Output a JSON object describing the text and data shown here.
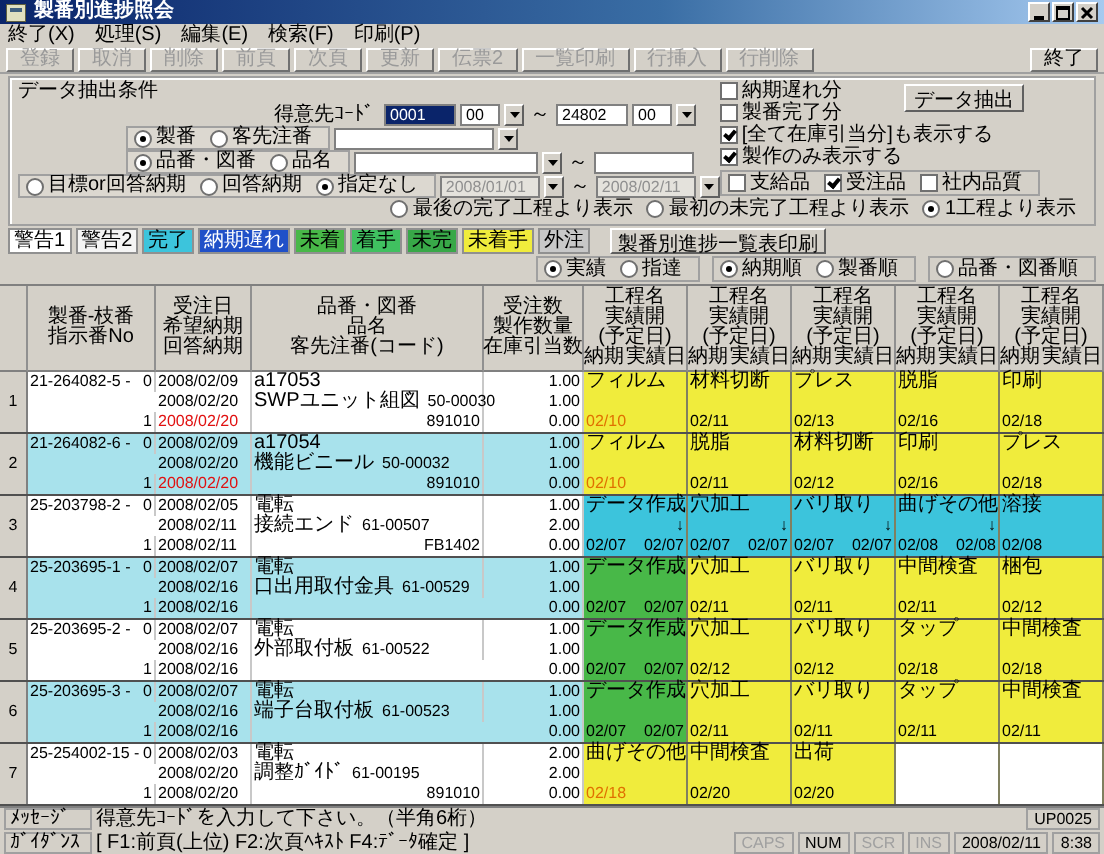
{
  "window": {
    "title": "製番別進捗照会"
  },
  "menu": [
    "終了(X)",
    "処理(S)",
    "編集(E)",
    "検索(F)",
    "印刷(P)"
  ],
  "toolbar": [
    {
      "label": "登録",
      "disabled": true
    },
    {
      "label": "取消",
      "disabled": true
    },
    {
      "label": "削除",
      "disabled": true
    },
    {
      "label": "前頁",
      "disabled": true
    },
    {
      "label": "次頁",
      "disabled": true
    },
    {
      "label": "更新",
      "disabled": true
    },
    {
      "label": "伝票2",
      "disabled": true
    },
    {
      "label": "一覧印刷",
      "disabled": true
    },
    {
      "label": "行挿入",
      "disabled": true
    },
    {
      "label": "行削除",
      "disabled": true
    },
    {
      "label": "終了",
      "disabled": false
    }
  ],
  "conditions": {
    "title": "データ抽出条件",
    "customer": {
      "label": "得意先ｺｰﾄﾞ",
      "from_code": "0001",
      "from_code_highlighted": true,
      "from_branch": "00",
      "separator": "～",
      "to_code": "24802",
      "to_branch": "00"
    },
    "order_type": [
      {
        "label": "製番",
        "selected": true
      },
      {
        "label": "客先注番",
        "selected": false
      }
    ],
    "part_type": [
      {
        "label": "品番・図番",
        "selected": true
      },
      {
        "label": "品名",
        "selected": false
      }
    ],
    "part_separator": "～",
    "date_type": [
      {
        "label": "目標or回答納期",
        "selected": false
      },
      {
        "label": "回答納期",
        "selected": false
      },
      {
        "label": "指定なし",
        "selected": true
      }
    ],
    "date_range": {
      "from": "2008/01/01",
      "separator": "～",
      "to": "2008/02/11",
      "disabled": true
    },
    "flags": [
      {
        "label": "納期遅れ分",
        "checked": false
      },
      {
        "label": "製番完了分",
        "checked": false
      },
      {
        "label": "[全て在庫引当分]も表示する",
        "checked": true
      },
      {
        "label": "製作のみ表示する",
        "checked": true
      }
    ],
    "extract_button": "データ抽出",
    "categories": [
      {
        "label": "支給品",
        "checked": false
      },
      {
        "label": "受注品",
        "checked": true
      },
      {
        "label": "社内品質",
        "checked": false
      }
    ],
    "display_from": [
      {
        "label": "最後の完了工程より表示",
        "selected": false
      },
      {
        "label": "最初の未完了工程より表示",
        "selected": false
      },
      {
        "label": "1工程より表示",
        "selected": true
      }
    ]
  },
  "legend": [
    {
      "label": "警告1",
      "color": "#ffffff"
    },
    {
      "label": "警告2",
      "color": "#f4f4f4"
    },
    {
      "label": "完了",
      "color": "#3cc4dc"
    },
    {
      "label": "納期遅れ",
      "color": "#2050c8"
    },
    {
      "label": "未着",
      "color": "#48b848"
    },
    {
      "label": "着手",
      "color": "#40c060"
    },
    {
      "label": "未完",
      "color": "#38a848"
    },
    {
      "label": "未着手",
      "color": "#f0ec3c"
    },
    {
      "label": "外注",
      "color": "#c8c8c8"
    }
  ],
  "print_button": "製番別進捗一覧表印刷",
  "view_mode": [
    {
      "label": "実績",
      "selected": true
    },
    {
      "label": "指達",
      "selected": false
    }
  ],
  "sort_order": [
    {
      "label": "納期順",
      "selected": true
    },
    {
      "label": "製番順",
      "selected": false
    },
    {
      "label": "品番・図番順",
      "selected": false
    }
  ],
  "table": {
    "columns": [
      [
        "製番-枝番",
        "指示番No"
      ],
      [
        "受注日",
        "希望納期",
        "回答納期"
      ],
      [
        "品番・図番",
        "品名",
        "客先注番(コード)"
      ],
      [
        "受注数",
        "製作数量",
        "在庫引当数"
      ]
    ],
    "process_columns": [
      {
        "name": "工程名",
        "start": "実績開(予定日)",
        "due": "納期",
        "actual": "実績日"
      },
      {
        "name": "工程名",
        "start": "実績開(予定日)",
        "due": "納期",
        "actual": "実績日"
      },
      {
        "name": "工程名",
        "start": "実績開(予定日)",
        "due": "納期",
        "actual": "実績日"
      },
      {
        "name": "工程名",
        "start": "実績開(予定日)",
        "due": "納期",
        "actual": "実績日"
      },
      {
        "name": "工程名",
        "start": "実績開(予定日)",
        "due": "納期",
        "actual": "実績日"
      }
    ],
    "rows": [
      {
        "number": "1",
        "shaded": false,
        "order_no": "21-264082-5 -",
        "seq": "0",
        "split": "1",
        "order_date": "2008/02/09",
        "due_date": "2008/02/20",
        "answer_date": "2008/02/20",
        "answer_late": true,
        "part_no": "a17053",
        "part_name": "SWPユニット組図",
        "drawing_no": "50-00030",
        "customer_code": "891010",
        "qty": "1.00",
        "make_qty": "1.00",
        "stock_qty": "0.00",
        "processes": [
          {
            "name": "フィルム",
            "kind": "pending",
            "due": "02/10",
            "due_late": true
          },
          {
            "name": "材料切断",
            "kind": "pending",
            "due": "02/11",
            "due_late": false
          },
          {
            "name": "プレス",
            "kind": "pending",
            "due": "02/13",
            "due_late": false
          },
          {
            "name": "脱脂",
            "kind": "pending",
            "due": "02/16",
            "due_late": false
          },
          {
            "name": "印刷",
            "kind": "pending",
            "due": "02/18",
            "due_late": false
          }
        ]
      },
      {
        "number": "2",
        "shaded": true,
        "order_no": "21-264082-6 -",
        "seq": "0",
        "split": "1",
        "order_date": "2008/02/09",
        "due_date": "2008/02/20",
        "answer_date": "2008/02/20",
        "answer_late": true,
        "part_no": "a17054",
        "part_name": "機能ビニール",
        "drawing_no": "50-00032",
        "customer_code": "891010",
        "qty": "1.00",
        "make_qty": "1.00",
        "stock_qty": "0.00",
        "processes": [
          {
            "name": "フィルム",
            "kind": "pending",
            "due": "02/10",
            "due_late": true
          },
          {
            "name": "脱脂",
            "kind": "pending",
            "due": "02/11",
            "due_late": false
          },
          {
            "name": "材料切断",
            "kind": "pending",
            "due": "02/12",
            "due_late": false
          },
          {
            "name": "印刷",
            "kind": "pending",
            "due": "02/16",
            "due_late": false
          },
          {
            "name": "プレス",
            "kind": "pending",
            "due": "02/18",
            "due_late": false
          }
        ]
      },
      {
        "number": "3",
        "shaded": false,
        "order_no": "25-203798-2 -",
        "seq": "0",
        "split": "1",
        "order_date": "2008/02/05",
        "due_date": "2008/02/11",
        "answer_date": "2008/02/11",
        "answer_late": false,
        "part_no": "電転",
        "part_name": "接続エンド",
        "drawing_no": "61-00507",
        "customer_code": "FB1402",
        "qty": "1.00",
        "make_qty": "2.00",
        "stock_qty": "0.00",
        "processes": [
          {
            "name": "データ作成",
            "kind": "done",
            "mark": "↓",
            "due": "02/07",
            "actual": "02/07",
            "due_late": false
          },
          {
            "name": "穴加工",
            "kind": "done",
            "mark": "↓",
            "due": "02/07",
            "actual": "02/07",
            "due_late": false
          },
          {
            "name": "バリ取り",
            "kind": "done",
            "mark": "↓",
            "due": "02/07",
            "actual": "02/07",
            "due_late": false
          },
          {
            "name": "曲げその他",
            "kind": "done",
            "mark": "↓",
            "due": "02/08",
            "actual": "02/08",
            "due_late": false
          },
          {
            "name": "溶接",
            "kind": "done",
            "due": "02/08",
            "due_late": false
          }
        ]
      },
      {
        "number": "4",
        "shaded": true,
        "order_no": "25-203695-1 -",
        "seq": "0",
        "split": "1",
        "order_date": "2008/02/07",
        "due_date": "2008/02/16",
        "answer_date": "2008/02/16",
        "answer_late": false,
        "part_no": "電転",
        "part_name": "口出用取付金具",
        "drawing_no": "61-00529",
        "qty": "1.00",
        "make_qty": "1.00",
        "stock_qty": "0.00",
        "processes": [
          {
            "name": "データ作成",
            "kind": "active",
            "due": "02/07",
            "actual": "02/07",
            "due_late": false
          },
          {
            "name": "穴加工",
            "kind": "pending",
            "due": "02/11",
            "due_late": false
          },
          {
            "name": "バリ取り",
            "kind": "pending",
            "due": "02/11",
            "due_late": false
          },
          {
            "name": "中間検査",
            "kind": "pending",
            "due": "02/11",
            "due_late": false
          },
          {
            "name": "梱包",
            "kind": "pending",
            "due": "02/12",
            "due_late": false
          }
        ]
      },
      {
        "number": "5",
        "shaded": false,
        "order_no": "25-203695-2 -",
        "seq": "0",
        "split": "1",
        "order_date": "2008/02/07",
        "due_date": "2008/02/16",
        "answer_date": "2008/02/16",
        "answer_late": false,
        "part_no": "電転",
        "part_name": "外部取付板",
        "drawing_no": "61-00522",
        "qty": "1.00",
        "make_qty": "1.00",
        "stock_qty": "0.00",
        "processes": [
          {
            "name": "データ作成",
            "kind": "active",
            "due": "02/07",
            "actual": "02/07",
            "due_late": false
          },
          {
            "name": "穴加工",
            "kind": "pending",
            "due": "02/12",
            "due_late": false
          },
          {
            "name": "バリ取り",
            "kind": "pending",
            "due": "02/12",
            "due_late": false
          },
          {
            "name": "タップ",
            "kind": "pending",
            "due": "02/18",
            "due_late": false
          },
          {
            "name": "中間検査",
            "kind": "pending",
            "due": "02/18",
            "due_late": false
          }
        ]
      },
      {
        "number": "6",
        "shaded": true,
        "order_no": "25-203695-3 -",
        "seq": "0",
        "split": "1",
        "order_date": "2008/02/07",
        "due_date": "2008/02/16",
        "answer_date": "2008/02/16",
        "answer_late": false,
        "part_no": "電転",
        "part_name": "端子台取付板",
        "drawing_no": "61-00523",
        "qty": "1.00",
        "make_qty": "1.00",
        "stock_qty": "0.00",
        "processes": [
          {
            "name": "データ作成",
            "kind": "active",
            "due": "02/07",
            "actual": "02/07",
            "due_late": false
          },
          {
            "name": "穴加工",
            "kind": "pending",
            "due": "02/11",
            "due_late": false
          },
          {
            "name": "バリ取り",
            "kind": "pending",
            "due": "02/11",
            "due_late": false
          },
          {
            "name": "タップ",
            "kind": "pending",
            "due": "02/11",
            "due_late": false
          },
          {
            "name": "中間検査",
            "kind": "pending",
            "due": "02/11",
            "due_late": false
          }
        ]
      },
      {
        "number": "7",
        "shaded": false,
        "order_no": "25-254002-15 -",
        "seq": "0",
        "split": "1",
        "order_date": "2008/02/03",
        "due_date": "2008/02/20",
        "answer_date": "2008/02/20",
        "answer_late": false,
        "part_no": "電転",
        "part_name": "調整ｶﾞｲﾄﾞ",
        "drawing_no": "61-00195",
        "customer_code": "891010",
        "qty": "2.00",
        "make_qty": "2.00",
        "stock_qty": "0.00",
        "processes": [
          {
            "name": "曲げその他",
            "kind": "pending",
            "due": "02/18",
            "due_late": true
          },
          {
            "name": "中間検査",
            "kind": "pending",
            "due": "02/20",
            "due_late": false
          },
          {
            "name": "出荷",
            "kind": "pending",
            "due": "02/20",
            "due_late": false
          },
          {
            "kind": "blank"
          },
          {
            "kind": "blank"
          }
        ]
      }
    ]
  },
  "status_bar": {
    "message_label": "ﾒｯｾｰｼﾞ",
    "message": "得意先ｺｰﾄﾞを入力して下さい。（半角6桁）",
    "program_id": "UP0025",
    "guidance_label": "ｶﾞｲﾀﾞﾝｽ",
    "guidance": "[ F1:前頁(上位) F2:次頁ﾍｷｽﾄ F4:ﾃﾞｰﾀ確定 ]",
    "indicators": [
      {
        "label": "CAPS",
        "on": false
      },
      {
        "label": "NUM",
        "on": true
      },
      {
        "label": "SCR",
        "on": false
      },
      {
        "label": "INS",
        "on": false
      }
    ],
    "date": "2008/02/11",
    "time": "8:38"
  }
}
